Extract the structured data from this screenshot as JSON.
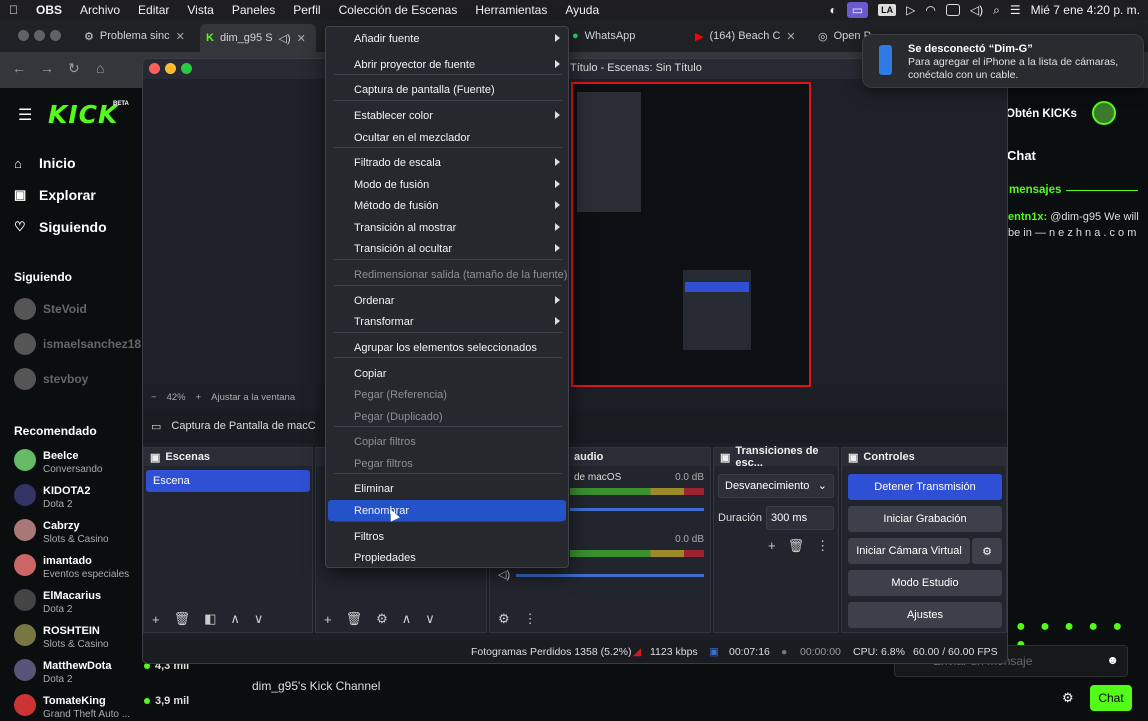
{
  "menubar": {
    "app": "OBS",
    "items": [
      "Archivo",
      "Editar",
      "Vista",
      "Paneles",
      "Perfil",
      "Colección de Escenas",
      "Herramientas",
      "Ayuda"
    ],
    "input_lang": "LA",
    "clock": "Mié 7 ene  4:20 p. m."
  },
  "browser": {
    "tabs": [
      {
        "title": "Problema sinc"
      },
      {
        "title": "dim_g95 S"
      },
      {
        "title": "WhatsApp"
      },
      {
        "title": "(164) Beach C"
      },
      {
        "title": "Open P"
      }
    ]
  },
  "kick": {
    "logo": "KICK",
    "beta": "BETA",
    "nav": [
      {
        "label": "Inicio",
        "icon": "home-icon"
      },
      {
        "label": "Explorar",
        "icon": "compass-icon"
      },
      {
        "label": "Siguiendo",
        "icon": "heart-icon"
      }
    ],
    "following_title": "Siguiendo",
    "following": [
      "SteVoid",
      "ismaelsanchez18",
      "stevboy"
    ],
    "recommended_title": "Recomendado",
    "recommended": [
      {
        "name": "Beelce",
        "category": "Conversando"
      },
      {
        "name": "KIDOTA2",
        "category": "Dota 2"
      },
      {
        "name": "Cabrzy",
        "category": "Slots & Casino"
      },
      {
        "name": "imantado",
        "category": "Eventos especiales"
      },
      {
        "name": "ElMacarius",
        "category": "Dota 2"
      },
      {
        "name": "ROSHTEIN",
        "category": "Slots & Casino"
      },
      {
        "name": "MatthewDota",
        "category": "Dota 2",
        "viewers": "4,3 mil"
      },
      {
        "name": "TomateKing",
        "category": "Grand Theft Auto ...",
        "viewers": "3,9 mil"
      }
    ],
    "get_kicks": "Obtén KICKs",
    "chat_title": "Chat",
    "chat_pinned_title": "mensajes",
    "chat_user": "entn1x:",
    "chat_message": "@dim-g95 We will",
    "chat_message2": "be in — n e z h n a . c o m",
    "channel_desc": "dim_g95's Kick Channel",
    "chat_placeholder": "Enviar un mensaje",
    "chat_button": "Chat"
  },
  "obs": {
    "title": "Título - Escenas: Sin Título",
    "zoom": "42%",
    "fit": "Ajustar a la ventana",
    "source_bar": "Captura de Pantalla de macC",
    "docks": {
      "scenes": "Escenas",
      "scene_item": "Escena",
      "audio": "audio",
      "audio_track1": "de macOS",
      "audio_db1": "0.0 dB",
      "audio_db2": "0.0 dB",
      "transitions": "Transiciones de esc...",
      "transition_value": "Desvanecimiento",
      "duration_label": "Duración",
      "duration_value": "300 ms",
      "controls": "Controles",
      "btn_stop": "Detener Transmisión",
      "btn_record": "Iniciar Grabación",
      "btn_vcam": "Iniciar Cámara Virtual",
      "btn_studio": "Modo Estudio",
      "btn_settings": "Ajustes"
    },
    "status": {
      "dropped": "Fotogramas Perdidos 1358 (5.2%)",
      "bitrate": "1123 kbps",
      "stream_time": "00:07:16",
      "rec_time": "00:00:00",
      "cpu": "CPU: 6.8%",
      "fps": "60.00 / 60.00 FPS"
    }
  },
  "context_menu": [
    {
      "label": "Añadir fuente",
      "sub": true
    },
    {
      "label": "Abrir proyector de fuente",
      "sub": true
    },
    {
      "label": "Captura de pantalla (Fuente)"
    },
    {
      "label": "Establecer color",
      "sub": true
    },
    {
      "label": "Ocultar en el mezclador"
    },
    {
      "label": "Filtrado de escala",
      "sub": true
    },
    {
      "label": "Modo de fusión",
      "sub": true
    },
    {
      "label": "Método de fusión",
      "sub": true
    },
    {
      "label": "Transición al mostrar",
      "sub": true
    },
    {
      "label": "Transición al ocultar",
      "sub": true
    },
    {
      "label": "Redimensionar salida (tamaño de la fuente)",
      "disabled": true
    },
    {
      "label": "Ordenar",
      "sub": true
    },
    {
      "label": "Transformar",
      "sub": true
    },
    {
      "label": "Agrupar los elementos seleccionados"
    },
    {
      "label": "Copiar"
    },
    {
      "label": "Pegar (Referencia)",
      "disabled": true
    },
    {
      "label": "Pegar (Duplicado)",
      "disabled": true
    },
    {
      "label": "Copiar filtros",
      "disabled": true
    },
    {
      "label": "Pegar filtros",
      "disabled": true
    },
    {
      "label": "Eliminar"
    },
    {
      "label": "Renombrar",
      "selected": true
    },
    {
      "label": "Filtros"
    },
    {
      "label": "Propiedades"
    }
  ],
  "notification": {
    "title": "Se desconectó “Dim-G”",
    "body": "Para agregar el iPhone a la lista de cámaras, conéctalo con un cable."
  },
  "colors": {
    "kick_green": "#53fc18",
    "obs_blue": "#2f4fd4",
    "live_red": "#e0151b"
  }
}
